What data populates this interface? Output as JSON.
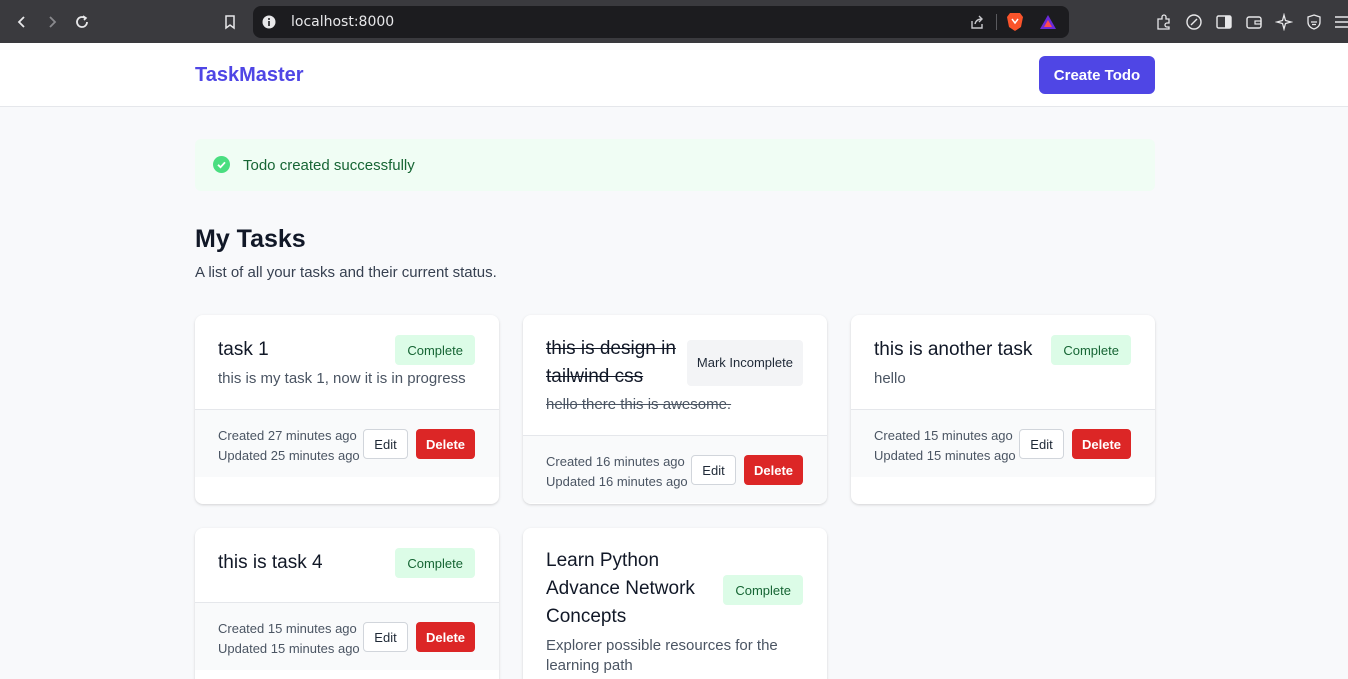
{
  "browser": {
    "url": "localhost:8000"
  },
  "nav": {
    "brand": "TaskMaster",
    "create_button": "Create Todo"
  },
  "alert": {
    "message": "Todo created successfully"
  },
  "page": {
    "title": "My Tasks",
    "subtitle": "A list of all your tasks and their current status."
  },
  "tasks": [
    {
      "title": "task 1",
      "description": "this is my task 1, now it is in progress",
      "status": "Complete",
      "created": "Created 27 minutes ago",
      "updated": "Updated 25 minutes ago",
      "edit": "Edit",
      "delete": "Delete"
    },
    {
      "title": "this is design in tailwind css",
      "description": "hello there this is awesome.",
      "status": "Mark Incomplete",
      "created": "Created 16 minutes ago",
      "updated": "Updated 16 minutes ago",
      "edit": "Edit",
      "delete": "Delete"
    },
    {
      "title": "this is another task",
      "description": "hello",
      "status": "Complete",
      "created": "Created 15 minutes ago",
      "updated": "Updated 15 minutes ago",
      "edit": "Edit",
      "delete": "Delete"
    },
    {
      "title": "this is task 4",
      "description": "",
      "status": "Complete",
      "created": "Created 15 minutes ago",
      "updated": "Updated 15 minutes ago",
      "edit": "Edit",
      "delete": "Delete"
    },
    {
      "title": "Learn Python Advance Network Concepts",
      "description": "Explorer possible resources for the learning path",
      "status": "Complete"
    }
  ],
  "colors": {
    "brand": "#4f46e5",
    "success_bg": "#f0fdf4",
    "badge_bg": "#dcfce7",
    "danger": "#dc2626"
  }
}
